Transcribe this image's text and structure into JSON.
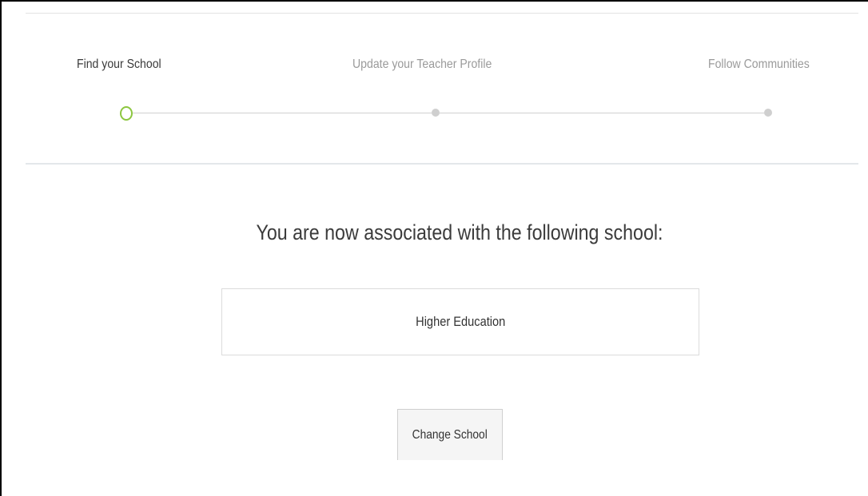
{
  "stepper": {
    "steps": [
      {
        "label": "Find your School",
        "state": "current"
      },
      {
        "label": "Update your Teacher Profile",
        "state": "upcoming"
      },
      {
        "label": "Follow Communities",
        "state": "upcoming"
      }
    ]
  },
  "main": {
    "heading": "You are now associated with the following school:",
    "school_name": "Higher Education",
    "change_school_label": "Change School"
  },
  "colors": {
    "accent": "#8cc63f",
    "inactive_step": "#cfcfcf",
    "active_text": "#3a3a3a",
    "inactive_text": "#9a9a9a"
  }
}
